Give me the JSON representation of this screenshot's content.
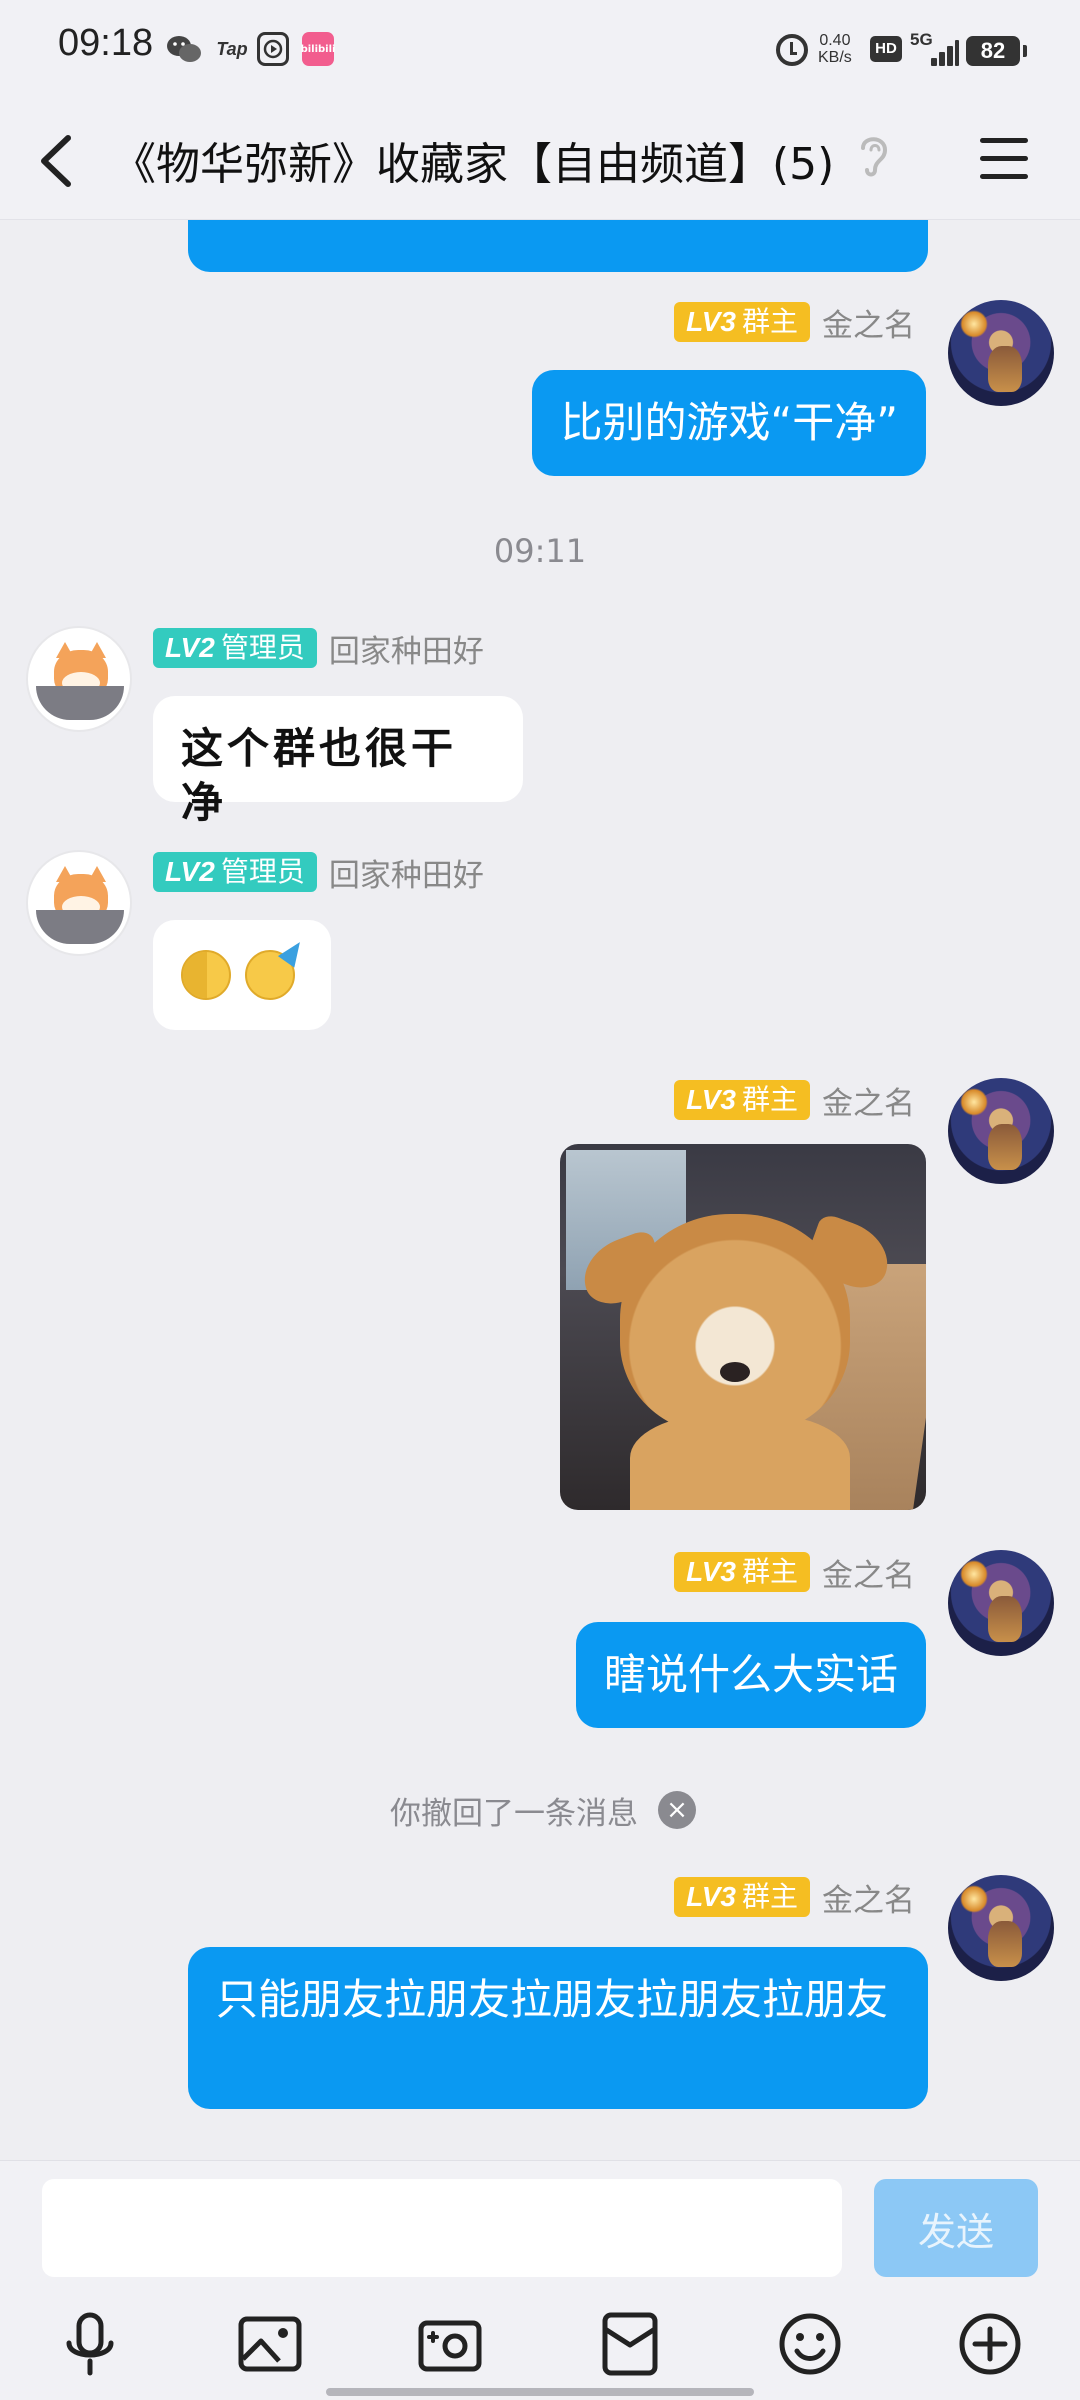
{
  "status_bar": {
    "time": "09:18",
    "tap_label": "Tap",
    "bili_label": "bilibili",
    "speed_value": "0.40",
    "speed_unit": "KB/s",
    "hd_label": "HD",
    "network": "5G",
    "battery": "82"
  },
  "header": {
    "title": "《物华弥新》收藏家【自由频道】(5)"
  },
  "messages": [
    {
      "side": "me",
      "level": "LV3",
      "role": "群主",
      "sender": "金之名",
      "text": "比别的游戏“干净”"
    },
    {
      "type": "time",
      "text": "09:11"
    },
    {
      "side": "them",
      "level": "LV2",
      "role": "管理员",
      "sender": "回家种田好",
      "text": "这个群也很干净"
    },
    {
      "side": "them",
      "level": "LV2",
      "role": "管理员",
      "sender": "回家种田好",
      "emojis": [
        "thinking-face",
        "partying-face"
      ]
    },
    {
      "side": "me",
      "level": "LV3",
      "role": "群主",
      "sender": "金之名",
      "image": "shiba-dog-sticker"
    },
    {
      "side": "me",
      "level": "LV3",
      "role": "群主",
      "sender": "金之名",
      "text": "瞎说什么大实话"
    },
    {
      "type": "recall",
      "text": "你撤回了一条消息"
    },
    {
      "side": "me",
      "level": "LV3",
      "role": "群主",
      "sender": "金之名",
      "text": "只能朋友拉朋友拉朋友拉朋友拉朋友"
    }
  ],
  "input_bar": {
    "placeholder": "",
    "send_label": "发送"
  },
  "toolbar": {
    "icons": [
      "microphone-icon",
      "image-icon",
      "camera-icon",
      "red-packet-icon",
      "emoji-icon",
      "plus-icon"
    ]
  },
  "colors": {
    "my_bubble": "#0a99f2",
    "owner_badge": "#f5be22",
    "admin_badge": "#33cbbf",
    "background": "#eeeef2"
  }
}
